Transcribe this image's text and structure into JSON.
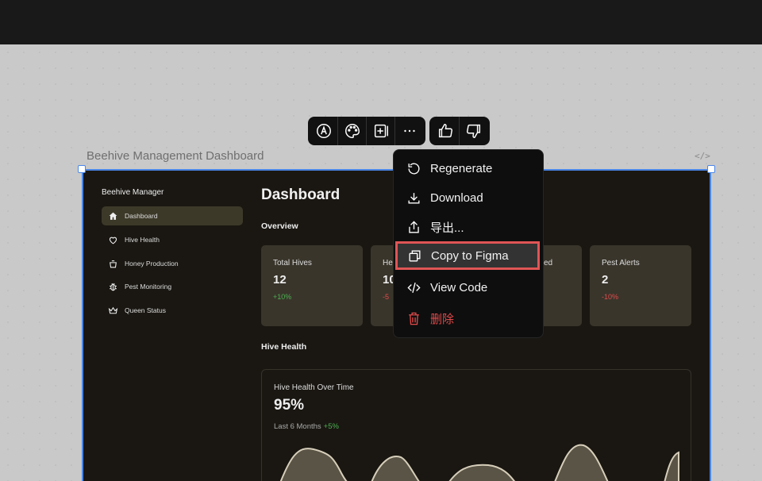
{
  "frame": {
    "title": "Beehive Management Dashboard",
    "code_tag": "</>"
  },
  "toolbar": {
    "group1": [
      "text-style-icon",
      "palette-icon",
      "add-frame-icon",
      "more-icon"
    ],
    "group2": [
      "thumbs-up-icon",
      "thumbs-down-icon"
    ]
  },
  "sidebar": {
    "title": "Beehive Manager",
    "items": [
      {
        "label": "Dashboard",
        "icon": "home-icon",
        "active": true
      },
      {
        "label": "Hive Health",
        "icon": "heart-icon"
      },
      {
        "label": "Honey Production",
        "icon": "pot-icon"
      },
      {
        "label": "Pest Monitoring",
        "icon": "bug-icon"
      },
      {
        "label": "Queen Status",
        "icon": "crown-icon"
      }
    ]
  },
  "main": {
    "title": "Dashboard",
    "overview_label": "Overview",
    "cards": [
      {
        "label": "Total Hives",
        "value": "12",
        "change": "+10%",
        "trend": "positive"
      },
      {
        "label": "He",
        "value": "10",
        "change": "-5",
        "trend": "negative"
      },
      {
        "label": "ed",
        "value": "",
        "change": "",
        "trend": ""
      },
      {
        "label": "Pest Alerts",
        "value": "2",
        "change": "-10%",
        "trend": "negative"
      }
    ],
    "hive_health_label": "Hive Health",
    "chart": {
      "title": "Hive Health Over Time",
      "value": "95%",
      "subtitle": "Last 6 Months",
      "change": "+5%"
    }
  },
  "menu": {
    "items": [
      {
        "label": "Regenerate",
        "icon": "refresh-icon"
      },
      {
        "label": "Download",
        "icon": "download-icon"
      },
      {
        "label": "导出...",
        "icon": "share-icon"
      },
      {
        "label": "Copy to Figma",
        "icon": "copy-icon",
        "highlighted": true
      },
      {
        "label": "View Code",
        "icon": "code-icon"
      },
      {
        "label": "删除",
        "icon": "trash-icon",
        "danger": true
      }
    ]
  },
  "colors": {
    "accent": "#4a86e8",
    "danger": "#e04a4a",
    "positive": "#4caf50",
    "highlight_border": "#e05555"
  }
}
